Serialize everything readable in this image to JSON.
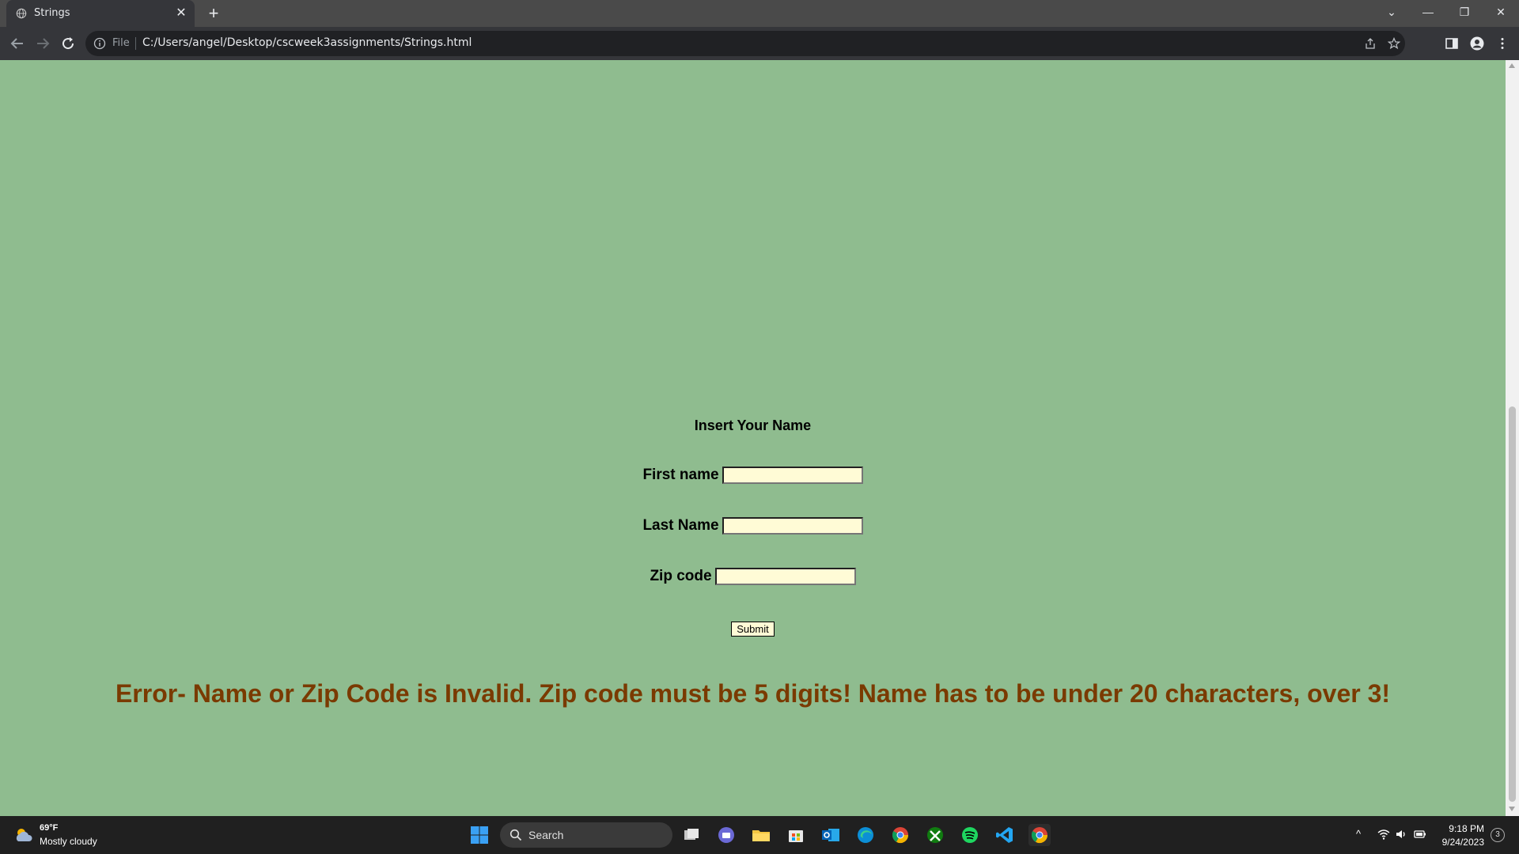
{
  "browser": {
    "tab_title": "Strings",
    "file_label": "File",
    "url": "C:/Users/angel/Desktop/cscweek3assignments/Strings.html"
  },
  "page": {
    "background_color": "#8fbc8f",
    "heading": "Insert Your Name",
    "fields": {
      "first_name_label": "First name",
      "first_name_value": "",
      "last_name_label": "Last Name",
      "last_name_value": "",
      "zip_label": "Zip code",
      "zip_value": ""
    },
    "submit_label": "Submit",
    "error_message": "Error- Name or Zip Code is Invalid. Zip code must be 5 digits! Name has to be under 20 characters, over 3!",
    "error_color": "#7a3a00",
    "input_bg_color": "#fffbd6"
  },
  "taskbar": {
    "weather_temp": "69°F",
    "weather_desc": "Mostly cloudy",
    "search_placeholder": "Search",
    "time": "9:18 PM",
    "date": "9/24/2023",
    "notification_count": "3",
    "apps": [
      "task-view",
      "teams-chat",
      "file-explorer",
      "microsoft-store",
      "outlook",
      "edge",
      "chrome",
      "xbox",
      "spotify",
      "vscode",
      "chrome-active"
    ]
  }
}
